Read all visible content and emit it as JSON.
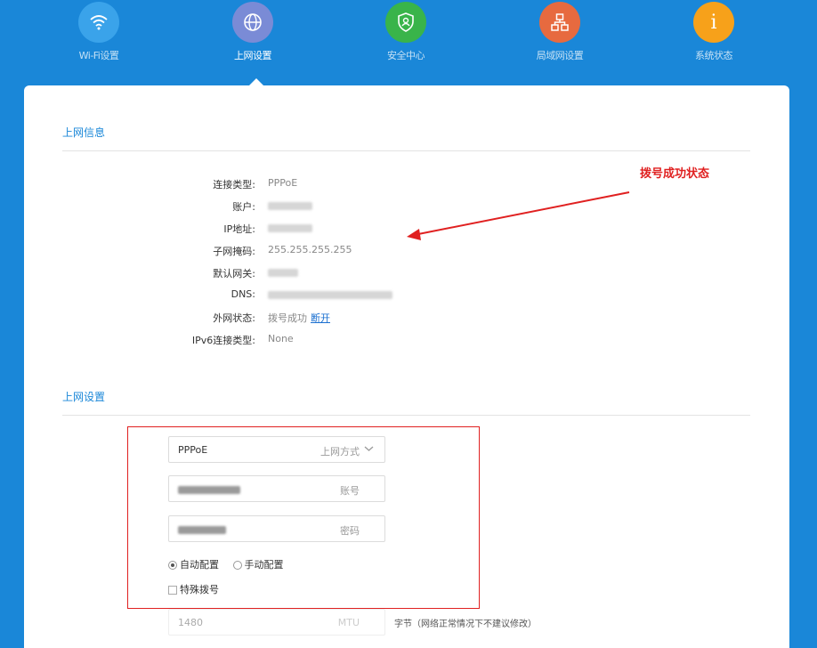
{
  "nav": {
    "items": [
      {
        "label": "Wi-Fi设置",
        "color": "#3aa3ea",
        "icon": "wifi-icon"
      },
      {
        "label": "上网设置",
        "color": "#7a8bd6",
        "icon": "globe-icon",
        "active": true
      },
      {
        "label": "安全中心",
        "color": "#39b44a",
        "icon": "shield-icon"
      },
      {
        "label": "局域网设置",
        "color": "#e76a3f",
        "icon": "network-icon"
      },
      {
        "label": "系统状态",
        "color": "#f7a11a",
        "icon": "info-icon"
      }
    ]
  },
  "info_section": {
    "title": "上网信息",
    "rows": [
      {
        "label": "连接类型:",
        "value": "PPPoE"
      },
      {
        "label": "账户:",
        "value": ""
      },
      {
        "label": "IP地址:",
        "value": ""
      },
      {
        "label": "子网掩码:",
        "value": "255.255.255.255"
      },
      {
        "label": "默认网关:",
        "value": ""
      },
      {
        "label": "DNS:",
        "value": ""
      },
      {
        "label": "外网状态:",
        "value": "拨号成功",
        "link": "断开"
      },
      {
        "label": "IPv6连接类型:",
        "value": "None"
      }
    ]
  },
  "annotation": {
    "text": "拨号成功状态",
    "color": "#e02020"
  },
  "settings_section": {
    "title": "上网设置",
    "mode_value": "PPPoE",
    "mode_label": "上网方式",
    "account_label": "账号",
    "password_label": "密码",
    "radio_auto": "自动配置",
    "radio_manual": "手动配置",
    "special_dial": "特殊拨号",
    "mtu_value": "1480",
    "mtu_label": "MTU",
    "mtu_hint": "字节（网络正常情况下不建议修改）"
  },
  "colors": {
    "background": "#1a87d8",
    "accent": "#1a87d8"
  }
}
